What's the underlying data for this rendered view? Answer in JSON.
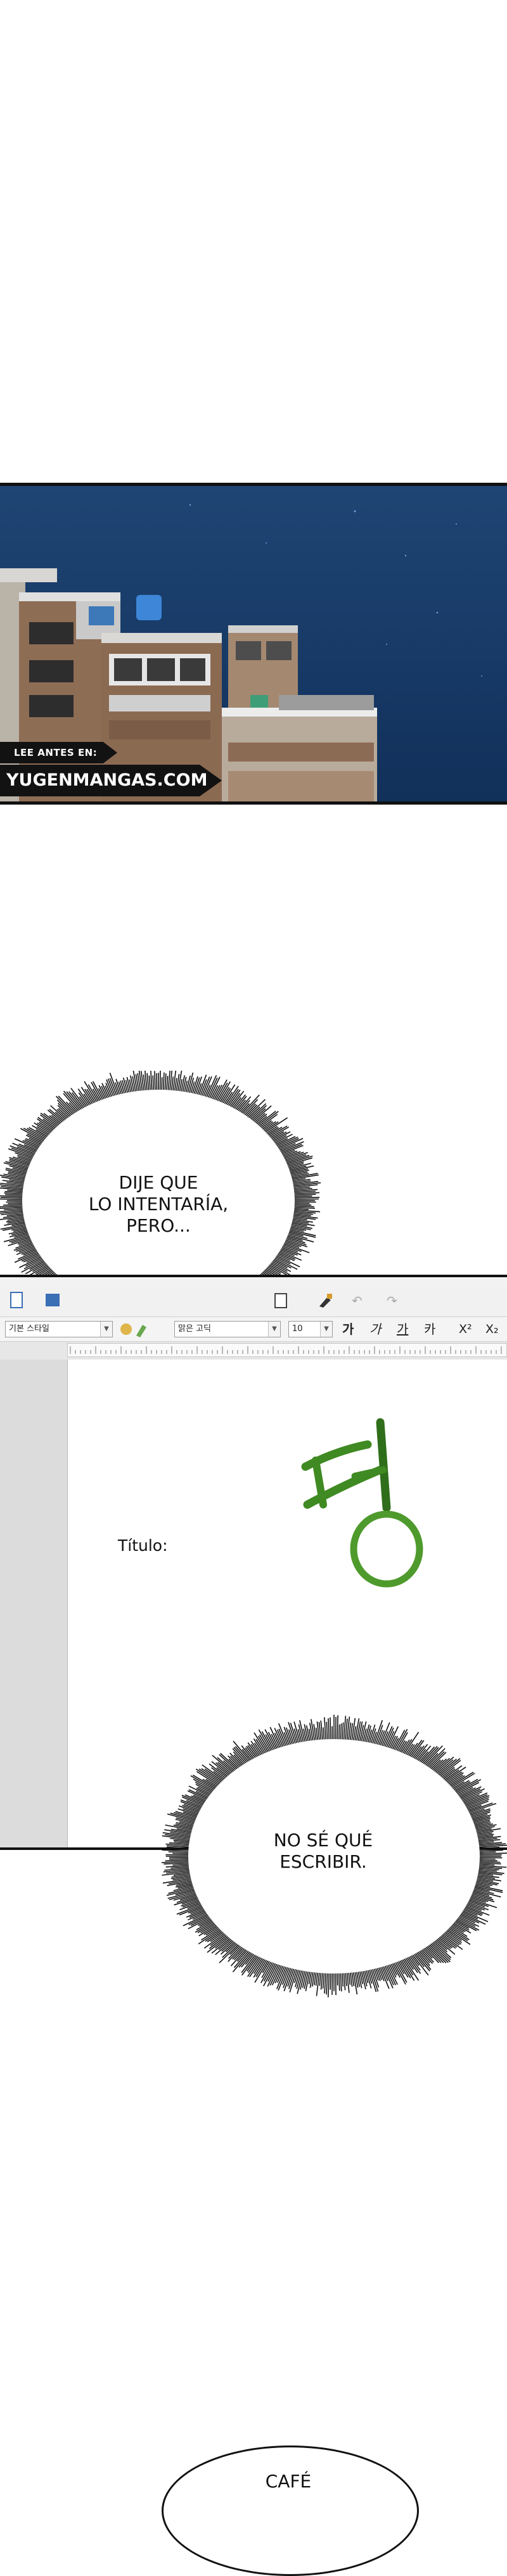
{
  "watermark": {
    "line1": "LEE ANTES EN:",
    "line2": "YUGENMANGAS.COM"
  },
  "bubbles": {
    "first": [
      "DIJE QUE",
      "LO INTENTARÍA,",
      "PERO..."
    ],
    "second": [
      "NO SÉ QUÉ",
      "ESCRIBIR."
    ],
    "third": "CAFÉ"
  },
  "editor": {
    "style_select": "기본 스타일",
    "font_select": "맑은 고딕",
    "size_select": "10",
    "format_buttons": [
      "가",
      "가",
      "가",
      "카"
    ],
    "superscript": "X²",
    "subscript": "X₂",
    "title_label": "Título:",
    "logo_char": "텅",
    "logo_color": "#3f8a22"
  },
  "colors": {
    "sky_top": "#1b3d66",
    "sky_bottom": "#0f2a4d"
  }
}
